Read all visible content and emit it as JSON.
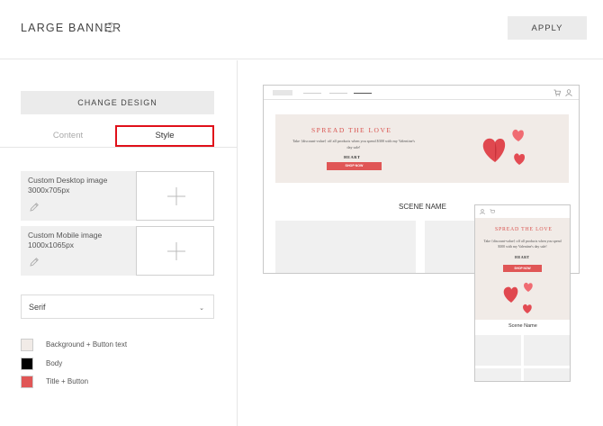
{
  "header": {
    "title": "LARGE BANNER",
    "help_glyph": "?",
    "apply_label": "APPLY"
  },
  "panel": {
    "change_design_label": "CHANGE DESIGN",
    "tabs": [
      {
        "label": "Content",
        "active": false
      },
      {
        "label": "Style",
        "active": true
      }
    ],
    "images": [
      {
        "title": "Custom Desktop image",
        "size": "3000x705px"
      },
      {
        "title": "Custom Mobile image",
        "size": "1000x1065px"
      }
    ],
    "font": {
      "value": "Serif",
      "chevron": "⌄"
    },
    "colors": [
      {
        "label": "Background + Button text",
        "hex": "#f1ebe7"
      },
      {
        "label": "Body",
        "hex": "#000000"
      },
      {
        "label": "Title + Button",
        "hex": "#e05656"
      }
    ]
  },
  "preview": {
    "banner_title": "SPREAD THE LOVE",
    "banner_text_desktop": "Take {discount-value} off all products when you spend $300 with my Valentine's day sale!",
    "banner_text_mobile": "Take {discount-value} off all products when you spend $300 with my Valentine's day sale!",
    "code": "HEART",
    "shop_label": "SHOP NOW",
    "scene_name_desktop": "SCENE NAME",
    "scene_name_mobile": "Scene Name"
  },
  "colors": {
    "accent": "#e05656",
    "tab_highlight": "#e0101a",
    "banner_bg": "#f1ebe7"
  },
  "icons": {
    "help": "help-icon",
    "pencil": "pencil-icon",
    "plus": "plus-icon",
    "cart": "cart-icon",
    "user": "user-icon",
    "heart": "heart-icon"
  }
}
